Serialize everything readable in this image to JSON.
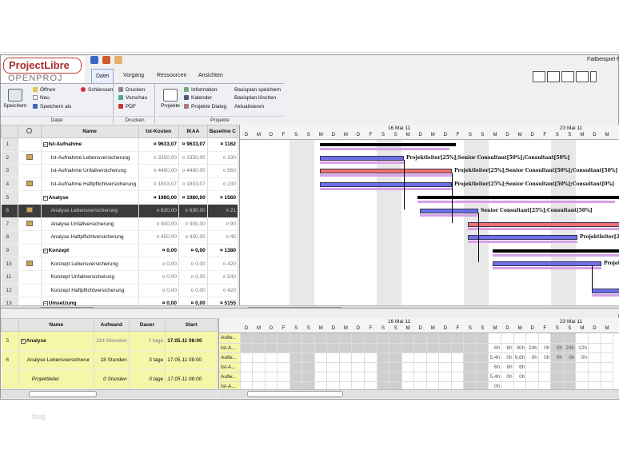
{
  "app": {
    "logo": "ProjectLibre",
    "logo_sub": "OPENPROJ",
    "document_title": "Fallbeispiel F"
  },
  "tabs": [
    "Datei",
    "Vorgang",
    "Ressourcen",
    "Ansichten"
  ],
  "ribbon": {
    "datei": {
      "group_label": "Datei",
      "big_button": "Speichern",
      "items": [
        "Öffnen",
        "Neu",
        "Speichern als"
      ],
      "close": "Schliessen"
    },
    "drucken": {
      "group_label": "Drucken",
      "items": [
        "Drucken",
        "Vorschau",
        "PDF"
      ]
    },
    "projekte": {
      "group_label": "Projekte",
      "big_button": "Projekte",
      "col1": [
        "Information",
        "Kalender",
        "Projekte Dialog"
      ],
      "col2": [
        "Basisplan speichern",
        "Basisplan löschen",
        "Aktualisieren"
      ]
    }
  },
  "task_table": {
    "headers": [
      "",
      "Name",
      "Ist-Kosten",
      "IKAA",
      "Baseline C"
    ],
    "rows": [
      {
        "n": "1",
        "name": "Ist-Aufnahme",
        "cost": "9633,07",
        "ikaa": "9633,07",
        "base": "1162",
        "summary": true,
        "note": false
      },
      {
        "n": "2",
        "name": "Ist-Aufnahme Lebensversicherung",
        "cost": "3350,00",
        "ikaa": "3350,00",
        "base": "330",
        "summary": false,
        "note": true
      },
      {
        "n": "3",
        "name": "Ist-Aufnahme Unfallversicherung",
        "cost": "4480,00",
        "ikaa": "4480,00",
        "base": "560",
        "summary": false,
        "note": false
      },
      {
        "n": "4",
        "name": "Ist-Aufnahme Haftpflichtversicherung",
        "cost": "1803,07",
        "ikaa": "1803,07",
        "base": "230",
        "summary": false,
        "note": true
      },
      {
        "n": "5",
        "name": "Analyse",
        "cost": "1980,00",
        "ikaa": "1980,00",
        "base": "1560",
        "summary": true,
        "note": false
      },
      {
        "n": "6",
        "name": "Analyse Lebensversicherung",
        "cost": "630,00",
        "ikaa": "630,00",
        "base": "21",
        "summary": false,
        "note": true,
        "selected": true
      },
      {
        "n": "7",
        "name": "Analyse Unfallversicherung",
        "cost": "900,00",
        "ikaa": "900,00",
        "base": "90",
        "summary": false,
        "note": true
      },
      {
        "n": "8",
        "name": "Analyse Haftpflichtversicherung",
        "cost": "450,00",
        "ikaa": "450,00",
        "base": "45",
        "summary": false,
        "note": false
      },
      {
        "n": "9",
        "name": "Konzept",
        "cost": "0,00",
        "ikaa": "0,00",
        "base": "1380",
        "summary": true,
        "note": false
      },
      {
        "n": "10",
        "name": "Konzept Lebensversicherung",
        "cost": "0,00",
        "ikaa": "0,00",
        "base": "420",
        "summary": false,
        "note": true
      },
      {
        "n": "11",
        "name": "Konzept Unfallversicherung",
        "cost": "0,00",
        "ikaa": "0,00",
        "base": "540",
        "summary": false,
        "note": false
      },
      {
        "n": "12",
        "name": "Konzept Haftpflichtversicherung",
        "cost": "0,00",
        "ikaa": "0,00",
        "base": "420",
        "summary": false,
        "note": false
      },
      {
        "n": "13",
        "name": "Umsetzung",
        "cost": "0,00",
        "ikaa": "0,00",
        "base": "5155",
        "summary": true,
        "note": false
      }
    ]
  },
  "gantt": {
    "weeks": [
      "16 Mai 11",
      "23 Mai 11"
    ],
    "days": [
      "D",
      "M",
      "D",
      "F",
      "S",
      "S",
      "M",
      "D",
      "M",
      "D",
      "F",
      "S",
      "S",
      "M",
      "D",
      "M",
      "D",
      "F",
      "S",
      "S",
      "M",
      "D",
      "M",
      "D",
      "F",
      "S",
      "S",
      "M",
      "D",
      "M"
    ],
    "labels": [
      "Projektleiter[25%];Senior Consultant[50%];Consultant[50%]",
      "Projektleiter[25%];Senior Consultant[50%];Consultant[50%]",
      "Projektleiter[25%];Senior Consultant[50%];Consultant[0%]",
      "Senior Consultant[25%];Consultant[50%]",
      "Projektleiter[25%];Senior Consultant[50%]",
      "Projektleiter[25%];Senior",
      "Pro"
    ],
    "scroll_glyph": "III"
  },
  "resource_table": {
    "headers": [
      "Name",
      "Aufwand",
      "Dauer",
      "Start"
    ],
    "rows": [
      {
        "n": "5",
        "name": "Analyse",
        "aufwand": "114 Stunden",
        "dauer": "7 tage",
        "start": "17.05.11 08:00",
        "summary": true
      },
      {
        "n": "6",
        "name": "Analyse Lebensversicherur",
        "aufwand": "18 Stunden",
        "dauer": "3 tage",
        "start": "17.05.11 08:00",
        "summary": false
      },
      {
        "n": "",
        "name": "Projektleiter",
        "aufwand": "0 Stunden",
        "dauer": "0 tage",
        "start": "17.05.11 08:00",
        "summary": false
      }
    ]
  },
  "usage": {
    "rows": [
      {
        "label": "Aufw...",
        "vals": [
          "",
          "",
          "",
          "",
          "",
          "",
          "",
          "",
          "",
          "",
          "",
          "",
          "",
          "",
          "",
          "",
          "",
          "",
          "",
          "",
          "",
          "",
          "",
          "",
          "",
          "",
          "",
          "",
          "",
          ""
        ]
      },
      {
        "label": "Ist-A...",
        "vals": [
          "",
          "",
          "",
          "",
          "",
          "",
          "",
          "",
          "",
          "",
          "",
          "",
          "",
          "",
          "",
          "",
          "",
          "",
          "",
          "",
          "6h",
          "6h",
          "30h",
          "24h",
          "0h",
          "0h",
          "24h",
          "12h",
          "",
          ""
        ]
      },
      {
        "label": "Aufw...",
        "vals": [
          "",
          "",
          "",
          "",
          "",
          "",
          "",
          "",
          "",
          "",
          "",
          "",
          "",
          "",
          "",
          "",
          "",
          "",
          "",
          "",
          "5,4h",
          "0h",
          "9,6h",
          "0h",
          "0h",
          "0h",
          "0h",
          "0h",
          "",
          ""
        ]
      },
      {
        "label": "Ist-A...",
        "vals": [
          "",
          "",
          "",
          "",
          "",
          "",
          "",
          "",
          "",
          "",
          "",
          "",
          "",
          "",
          "",
          "",
          "",
          "",
          "",
          "",
          "6h",
          "6h",
          "6h",
          "",
          "",
          "",
          "",
          "",
          "",
          ""
        ]
      },
      {
        "label": "Aufw...",
        "vals": [
          "",
          "",
          "",
          "",
          "",
          "",
          "",
          "",
          "",
          "",
          "",
          "",
          "",
          "",
          "",
          "",
          "",
          "",
          "",
          "",
          "5,4h",
          "0h",
          "0h",
          "",
          "",
          "",
          "",
          "",
          "",
          ""
        ]
      },
      {
        "label": "Ist-A...",
        "vals": [
          "",
          "",
          "",
          "",
          "",
          "",
          "",
          "",
          "",
          "",
          "",
          "",
          "",
          "",
          "",
          "",
          "",
          "",
          "",
          "",
          "0h",
          "",
          "",
          "",
          "",
          "",
          "",
          "",
          "",
          ""
        ]
      }
    ]
  },
  "watermark": "blog",
  "colors": {
    "task_bar": "#6f6fe8",
    "critical_bar": "#ef7070",
    "baseline": "#d9a0e8",
    "selected_row": "#3c3c3c",
    "assignment_row": "#f6f6a8"
  }
}
